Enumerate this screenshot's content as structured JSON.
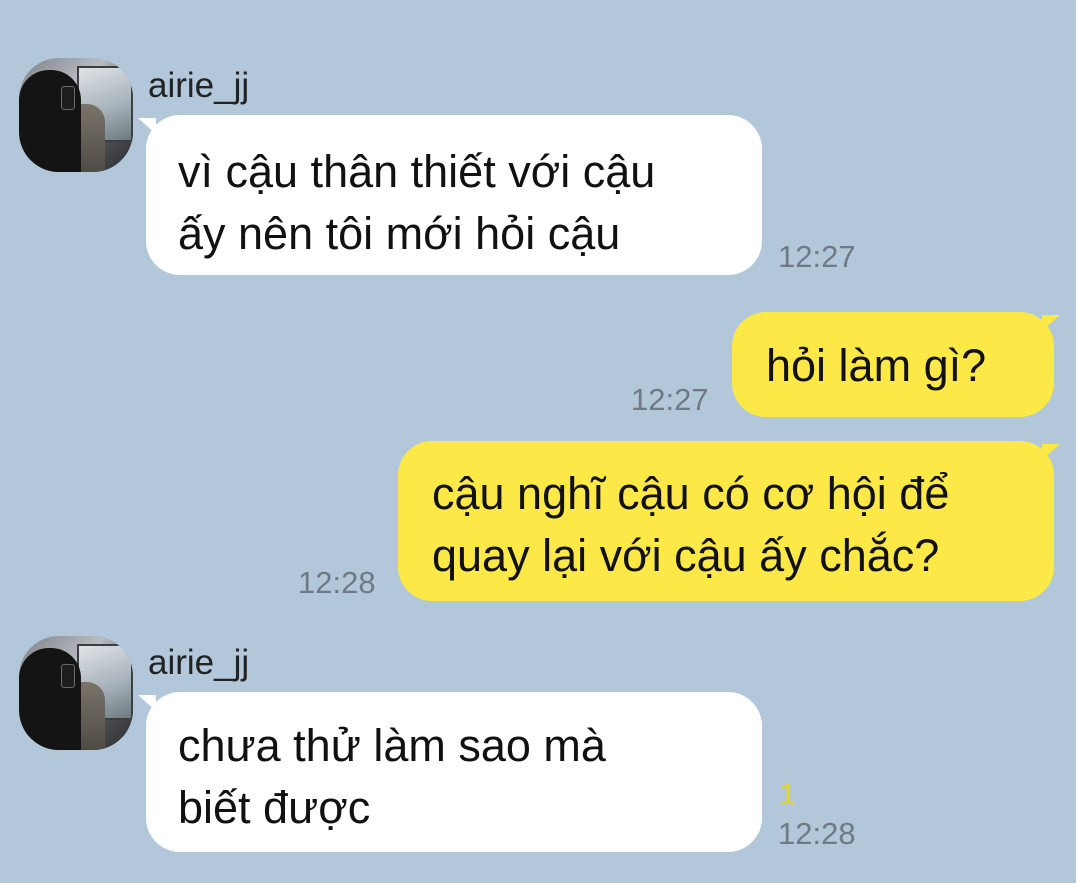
{
  "colors": {
    "background": "#b2c7da",
    "incoming_bubble": "#ffffff",
    "outgoing_bubble": "#fce846",
    "timestamp": "#6f7a84",
    "unread_count": "#e7d32b"
  },
  "messages": [
    {
      "direction": "incoming",
      "sender": "airie_jj",
      "avatar_icon": "profile-photo-avatar",
      "lines": [
        "vì cậu thân thiết với cậu",
        "ấy nên tôi mới hỏi cậu"
      ],
      "time": "12:27"
    },
    {
      "direction": "outgoing",
      "lines": [
        "hỏi làm gì?"
      ],
      "time": "12:27"
    },
    {
      "direction": "outgoing",
      "lines": [
        "cậu nghĩ cậu có cơ hội để",
        "quay lại với cậu ấy chắc?"
      ],
      "time": "12:28"
    },
    {
      "direction": "incoming",
      "sender": "airie_jj",
      "avatar_icon": "profile-photo-avatar",
      "lines": [
        "chưa thử làm sao mà",
        "biết được"
      ],
      "time": "12:28",
      "unread_count": "1"
    }
  ]
}
